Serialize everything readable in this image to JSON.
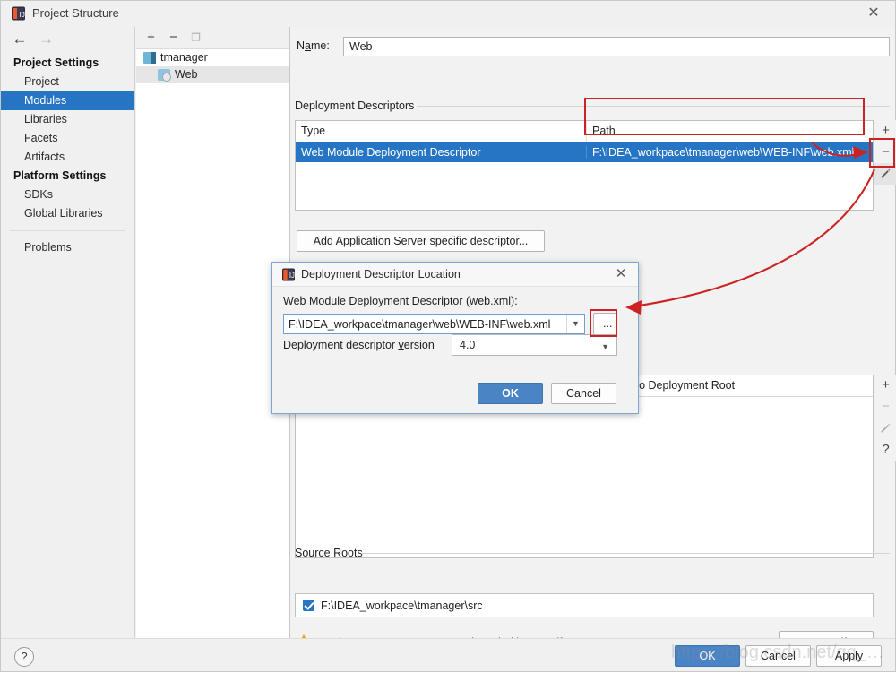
{
  "window": {
    "title": "Project Structure",
    "close_label": "✕",
    "app_icon": "intellij-idea-icon"
  },
  "sidebar": {
    "back_icon": "←",
    "forward_icon": "→",
    "groups": [
      {
        "label": "Project Settings"
      },
      {
        "label": "Platform Settings"
      }
    ],
    "items": [
      {
        "label": "Project",
        "selected": false
      },
      {
        "label": "Modules",
        "selected": true
      },
      {
        "label": "Libraries",
        "selected": false
      },
      {
        "label": "Facets",
        "selected": false
      },
      {
        "label": "Artifacts",
        "selected": false
      },
      {
        "label": "SDKs",
        "selected": false
      },
      {
        "label": "Global Libraries",
        "selected": false
      },
      {
        "label": "Problems",
        "selected": false
      }
    ]
  },
  "tree": {
    "toolbar": {
      "add": "+",
      "remove": "−",
      "copy": "❐"
    },
    "nodes": [
      {
        "label": "tmanager",
        "icon": "folder-icon",
        "selected": false
      },
      {
        "label": "Web",
        "icon": "web-module-icon",
        "selected": true
      }
    ]
  },
  "main": {
    "name_label": "Name:",
    "name_value": "Web",
    "deployment_descriptors": {
      "section_label": "Deployment Descriptors",
      "columns": [
        "Type",
        "Path"
      ],
      "rows": [
        {
          "type": "Web Module Deployment Descriptor",
          "path": "F:\\IDEA_workpace\\tmanager\\web\\WEB-INF\\web.xml",
          "selected": true
        }
      ],
      "side_buttons": [
        "+",
        "−",
        "✎"
      ]
    },
    "add_server_descriptor_label": "Add Application Server specific descriptor...",
    "web_resource_dirs": {
      "column": "Relative to Deployment Root",
      "side_buttons": [
        "+",
        "−",
        "✎",
        "?"
      ]
    },
    "source_roots": {
      "section_label": "Source Roots",
      "rows": [
        {
          "path": "F:\\IDEA_workpace\\tmanager\\src",
          "checked": true
        }
      ]
    },
    "warning": {
      "icon": "warning-triangle-icon",
      "text": "'Web' Facet resources are not included in an artifact",
      "action_label": "Create Artifact"
    }
  },
  "footer": {
    "help_label": "?",
    "ok_label": "OK",
    "cancel_label": "Cancel",
    "apply_label": "Apply"
  },
  "dialog": {
    "title": "Deployment Descriptor Location",
    "icon": "intellij-idea-icon",
    "close_label": "✕",
    "path_label": "Web Module Deployment Descriptor (web.xml):",
    "path_value": "F:\\IDEA_workpace\\tmanager\\web\\WEB-INF\\web.xml",
    "dropdown_caret": "▼",
    "browse_label": "...",
    "version_label_pre": "Deployment descriptor ",
    "version_label_underlined": "v",
    "version_label_post": "ersion",
    "version_value": "4.0",
    "version_caret": "▼",
    "ok_label": "OK",
    "cancel_label": "Cancel"
  },
  "watermark": {
    "text": "https://blog.csdn.net/qq_…"
  },
  "colors": {
    "accent_blue": "#2675c4",
    "button_blue": "#4a84c4",
    "annotation_red": "#cc2222",
    "warning_amber": "#f0a30a",
    "window_bg": "#f2f2f2"
  }
}
